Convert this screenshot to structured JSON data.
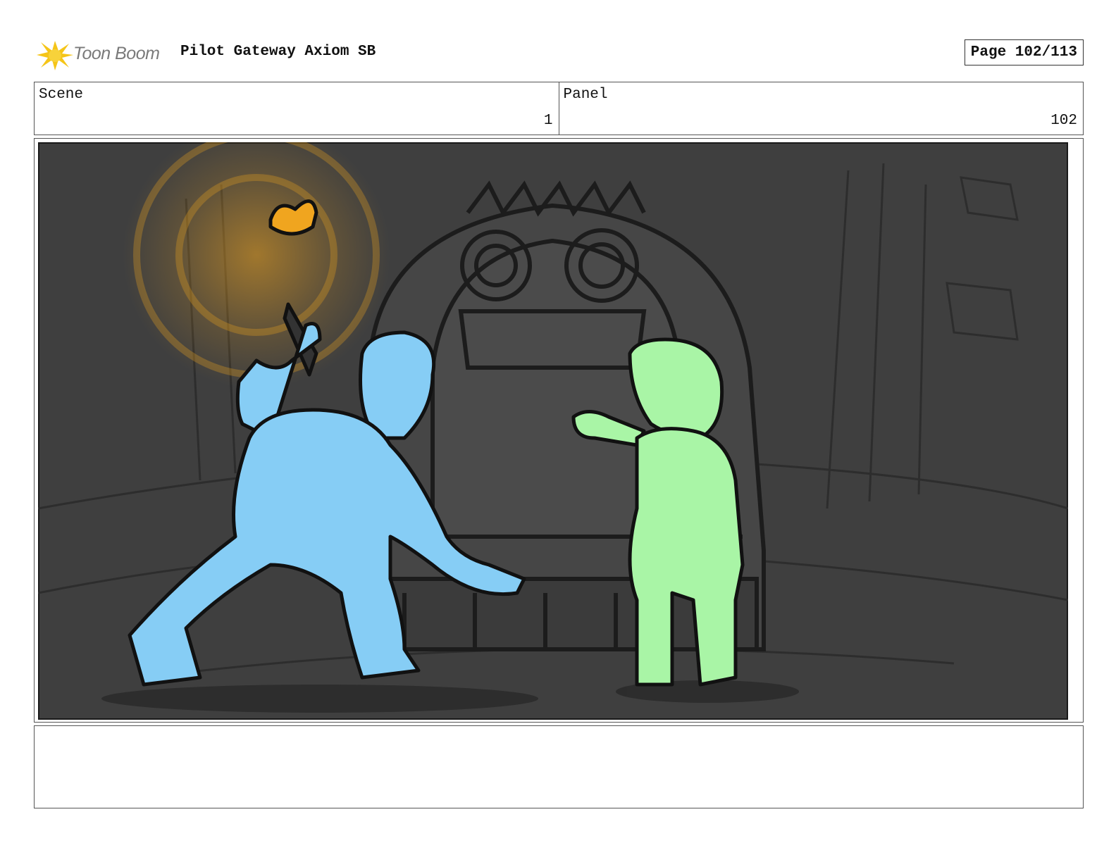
{
  "header": {
    "logo_text": "Toon Boom",
    "title": "Pilot Gateway Axiom SB",
    "page_label": "Page 102/113"
  },
  "info": {
    "scene_label": "Scene",
    "scene_value": "1",
    "panel_label": "Panel",
    "panel_value": "102"
  },
  "panel": {
    "description": ""
  },
  "colors": {
    "panel_bg": "#3f3f3f",
    "character_left": "#86cdf5",
    "character_right": "#a9f5a6",
    "torch_flame": "#f0a51f",
    "logo_accent": "#f5c518"
  }
}
